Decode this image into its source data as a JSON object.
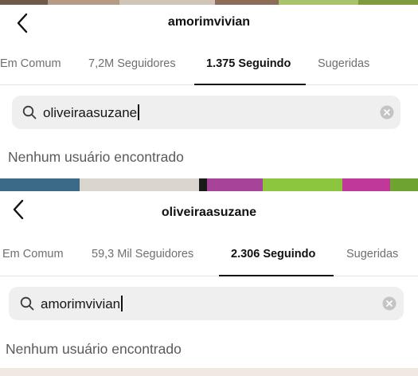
{
  "colors": {
    "text_primary": "#111111",
    "text_secondary": "#6f6f6f",
    "search_bg": "#efefef",
    "divider": "#e4e4e4",
    "background_photo_green": "#8cc63f",
    "background_photo_magenta": "#c0389a"
  },
  "icons": {
    "back": "chevron-left-icon",
    "search": "magnifier-icon",
    "clear": "circle-x-icon"
  },
  "top_screen": {
    "header": {
      "username": "amorimvivian"
    },
    "tabs": [
      {
        "label": "Em Comum",
        "active": false
      },
      {
        "label": "7,2M Seguidores",
        "active": false
      },
      {
        "label": "1.375 Seguindo",
        "active": true
      },
      {
        "label": "Sugeridas",
        "active": false
      }
    ],
    "search": {
      "value": "oliveiraasuzane"
    },
    "empty_message": "Nenhum usuário encontrado"
  },
  "bottom_screen": {
    "header": {
      "username": "oliveiraasuzane"
    },
    "tabs": [
      {
        "label": "Em Comum",
        "active": false
      },
      {
        "label": "59,3 Mil Seguidores",
        "active": false
      },
      {
        "label": "2.306 Seguindo",
        "active": true
      },
      {
        "label": "Sugeridas",
        "active": false
      }
    ],
    "search": {
      "value": "amorimvivian"
    },
    "empty_message": "Nenhum usuário encontrado"
  }
}
